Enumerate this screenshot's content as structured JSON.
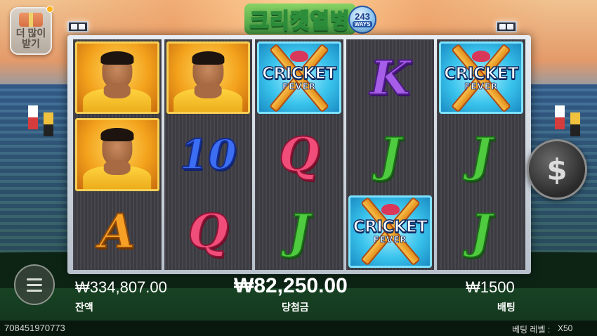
{
  "promo": {
    "label_line1": "더 많이",
    "label_line2": "받기"
  },
  "logo": {
    "title": "크리켓열병",
    "ways_number": "243",
    "ways_word": "WAYS"
  },
  "reels": [
    [
      {
        "type": "hero"
      },
      {
        "type": "hero"
      },
      {
        "type": "letter",
        "symbol": "A"
      }
    ],
    [
      {
        "type": "hero"
      },
      {
        "type": "letter",
        "symbol": "10"
      },
      {
        "type": "letter",
        "symbol": "Q"
      }
    ],
    [
      {
        "type": "wild",
        "title": "CRICKET",
        "sub": "FEVER"
      },
      {
        "type": "letter",
        "symbol": "Q"
      },
      {
        "type": "letter",
        "symbol": "J"
      }
    ],
    [
      {
        "type": "letter",
        "symbol": "K"
      },
      {
        "type": "letter",
        "symbol": "J"
      },
      {
        "type": "wild",
        "title": "CRICKET",
        "sub": "FEVER"
      }
    ],
    [
      {
        "type": "wild",
        "title": "CRICKET",
        "sub": "FEVER"
      },
      {
        "type": "letter",
        "symbol": "J"
      },
      {
        "type": "letter",
        "symbol": "J"
      }
    ]
  ],
  "spin_button": {
    "glyph": "$"
  },
  "info": {
    "balance_value": "₩334,807.00",
    "balance_label": "잔액",
    "win_value": "₩82,250.00",
    "win_label": "당첨금",
    "bet_value": "₩1500",
    "bet_label": "배팅"
  },
  "footer": {
    "session_id": "708451970773",
    "bet_level_label": "베팅 레벨 :",
    "bet_level_value": "X50"
  }
}
